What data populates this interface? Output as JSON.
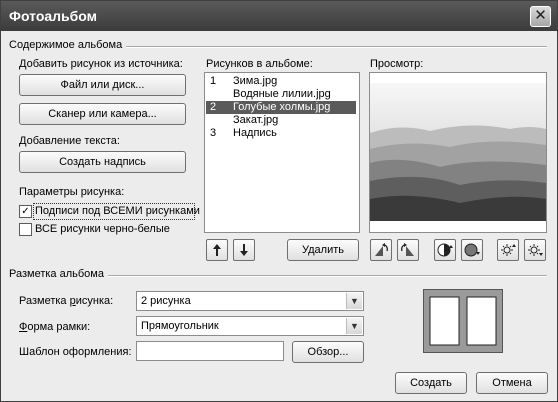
{
  "window": {
    "title": "Фотоальбом",
    "close_glyph": "✕"
  },
  "album_content": {
    "group_title": "Содержимое альбома",
    "add_picture_label": "Добавить рисунок из источника:",
    "file_or_disk_button": "Файл или диск...",
    "scanner_button": "Сканер или камера...",
    "add_text_label": "Добавление текста:",
    "create_caption_button": "Создать надпись",
    "picture_options_label": "Параметры рисунка:",
    "captions_all_checkbox": {
      "label": "Подписи под ВСЕМИ рисунками",
      "checked": true
    },
    "all_bw_checkbox": {
      "label": "ВСЕ рисунки черно-белые",
      "checked": false
    },
    "pictures_in_album_label": "Рисунков в альбоме:",
    "pictures": [
      {
        "num": "1",
        "name": "Зима.jpg",
        "selected": false
      },
      {
        "num": "",
        "name": "Водяные лилии.jpg",
        "selected": false
      },
      {
        "num": "2",
        "name": "Голубые холмы.jpg",
        "selected": true
      },
      {
        "num": "",
        "name": "Закат.jpg",
        "selected": false
      },
      {
        "num": "3",
        "name": "Надпись",
        "selected": false
      }
    ],
    "move_up_icon": "arrow-up-icon",
    "move_down_icon": "arrow-down-icon",
    "delete_button": "Удалить",
    "preview_label": "Просмотр:",
    "preview_tools": [
      "rotate-left-icon",
      "rotate-right-icon",
      "contrast-up-icon",
      "contrast-down-icon",
      "brightness-up-icon",
      "brightness-down-icon"
    ]
  },
  "album_layout": {
    "group_title": "Разметка альбома",
    "picture_layout_label": "Разметка рисунка:",
    "picture_layout_value": "2 рисунка",
    "frame_shape_label": "Форма рамки:",
    "frame_shape_value": "Прямоугольник",
    "theme_label": "Шаблон оформления:",
    "theme_value": "",
    "browse_button": "Обзор...",
    "layout_preview_icon": "two-pictures-layout-icon"
  },
  "footer": {
    "create_button": "Создать",
    "cancel_button": "Отмена"
  }
}
